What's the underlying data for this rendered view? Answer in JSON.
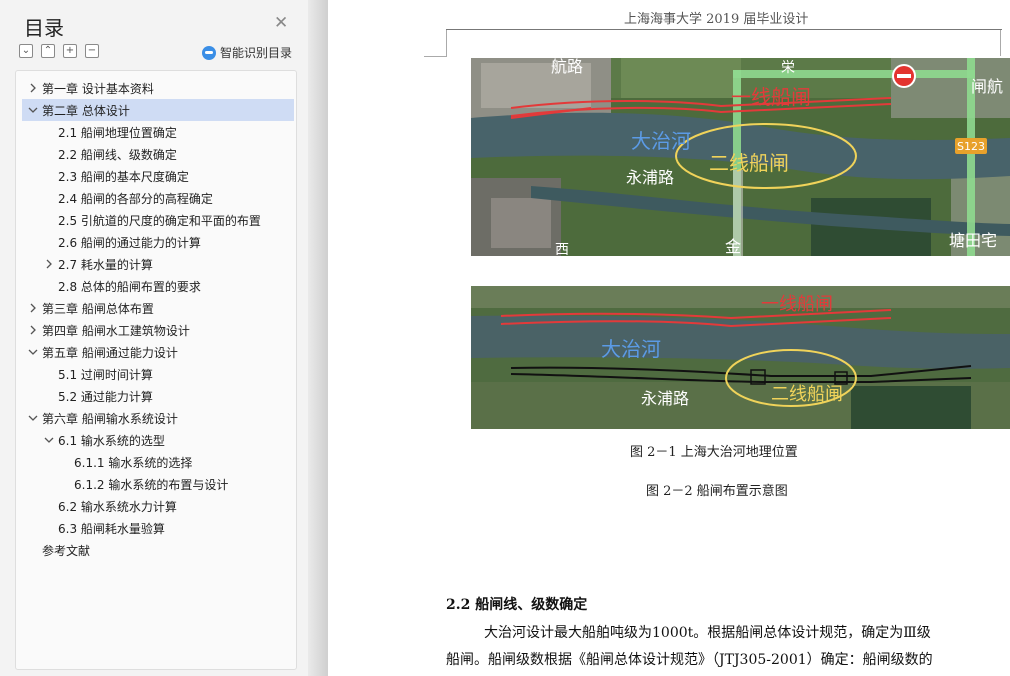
{
  "toc": {
    "title": "目录",
    "close_icon": "close-icon",
    "tools": [
      {
        "name": "collapse-all-button",
        "glyph": "⌄"
      },
      {
        "name": "expand-all-button",
        "glyph": "⌃"
      },
      {
        "name": "add-heading-button",
        "glyph": "+"
      },
      {
        "name": "remove-heading-button",
        "glyph": "−"
      }
    ],
    "smart_label": "智能识别目录",
    "items": [
      {
        "label": "第一章  设计基本资料",
        "level": 0,
        "arrow": "right"
      },
      {
        "label": "第二章  总体设计",
        "level": 0,
        "arrow": "down",
        "active": true
      },
      {
        "label": "2.1  船闸地理位置确定",
        "level": 1
      },
      {
        "label": "2.2  船闸线、级数确定",
        "level": 1
      },
      {
        "label": "2.3  船闸的基本尺度确定",
        "level": 1
      },
      {
        "label": "2.4  船闸的各部分的高程确定",
        "level": 1
      },
      {
        "label": "2.5  引航道的尺度的确定和平面的布置",
        "level": 1
      },
      {
        "label": "2.6  船闸的通过能力的计算",
        "level": 1
      },
      {
        "label": "2.7  耗水量的计算",
        "level": 1,
        "arrow": "right"
      },
      {
        "label": "2.8  总体的船闸布置的要求",
        "level": 1
      },
      {
        "label": "第三章  船闸总体布置",
        "level": 0,
        "arrow": "right"
      },
      {
        "label": "第四章  船闸水工建筑物设计",
        "level": 0,
        "arrow": "right"
      },
      {
        "label": "第五章  船闸通过能力设计",
        "level": 0,
        "arrow": "down"
      },
      {
        "label": "5.1 过闸时间计算",
        "level": 1
      },
      {
        "label": "5.2 通过能力计算",
        "level": 1
      },
      {
        "label": "第六章  船闸输水系统设计",
        "level": 0,
        "arrow": "down"
      },
      {
        "label": "6.1 输水系统的选型",
        "level": 1,
        "arrow": "down"
      },
      {
        "label": "6.1.1 输水系统的选择",
        "level": 2
      },
      {
        "label": "6.1.2 输水系统的布置与设计",
        "level": 2
      },
      {
        "label": "6.2 输水系统水力计算",
        "level": 1
      },
      {
        "label": "6.3 船闸耗水量验算",
        "level": 1
      },
      {
        "label": "参考文献",
        "level": 0
      }
    ]
  },
  "document": {
    "header": "上海海事大学 2019 届毕业设计",
    "map1_labels": {
      "line1": "一线船闸",
      "line2": "二线船闸",
      "river": "大治河",
      "road": "永浦路",
      "road_top": "航路",
      "badge": "S123",
      "right_top": "闸航",
      "right_bottom": "塘田宅",
      "bottom1": "西",
      "bottom2": "金",
      "top_mid": "栄"
    },
    "map2_labels": {
      "line1": "一线船闸",
      "line2": "二线船闸",
      "river": "大治河",
      "road": "永浦路"
    },
    "figure1_caption": "图 2－1    上海大治河地理位置",
    "figure2_caption": "图 2－2    船闸布置示意图",
    "section_heading": "2.2  船闸线、级数确定",
    "paragraph_lines": [
      "大治河设计最大船舶吨级为1000t。根据船闸总体设计规范，确定为Ⅲ级",
      "船闸。船闸级数根据《船闸总体设计规范》（JTJ305-2001）确定：船闸级数的"
    ]
  }
}
